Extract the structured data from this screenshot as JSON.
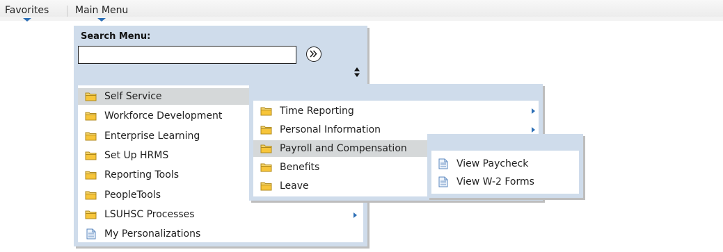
{
  "topnav": {
    "favorites_label": "Favorites",
    "main_menu_label": "Main Menu"
  },
  "search": {
    "label": "Search Menu:",
    "value": "",
    "placeholder": ""
  },
  "main_menu": {
    "items": [
      {
        "label": "Self Service",
        "icon": "folder-icon",
        "submenu": true,
        "highlighted": true
      },
      {
        "label": "Workforce Development",
        "icon": "folder-icon",
        "submenu": true
      },
      {
        "label": "Enterprise Learning",
        "icon": "folder-icon",
        "submenu": true
      },
      {
        "label": "Set Up HRMS",
        "icon": "folder-icon",
        "submenu": true
      },
      {
        "label": "Reporting Tools",
        "icon": "folder-icon",
        "submenu": true
      },
      {
        "label": "PeopleTools",
        "icon": "folder-icon",
        "submenu": true
      },
      {
        "label": "LSUHSC Processes",
        "icon": "folder-icon",
        "submenu": true
      },
      {
        "label": "My Personalizations",
        "icon": "document-icon",
        "submenu": false
      }
    ]
  },
  "self_service_menu": {
    "items": [
      {
        "label": "Time Reporting",
        "icon": "folder-icon",
        "submenu": true
      },
      {
        "label": "Personal Information",
        "icon": "folder-icon",
        "submenu": true
      },
      {
        "label": "Payroll and Compensation",
        "icon": "folder-icon",
        "submenu": true,
        "highlighted": true
      },
      {
        "label": "Benefits",
        "icon": "folder-icon",
        "submenu": true
      },
      {
        "label": "Leave",
        "icon": "folder-icon",
        "submenu": true
      }
    ]
  },
  "payroll_menu": {
    "items": [
      {
        "label": "View Paycheck",
        "icon": "document-icon"
      },
      {
        "label": "View W-2 Forms",
        "icon": "document-icon"
      }
    ]
  },
  "colors": {
    "panel_border": "#cfdceb",
    "highlight": "#d5d8d9",
    "folder": "#f5c842",
    "accent": "#2d6fb6"
  }
}
